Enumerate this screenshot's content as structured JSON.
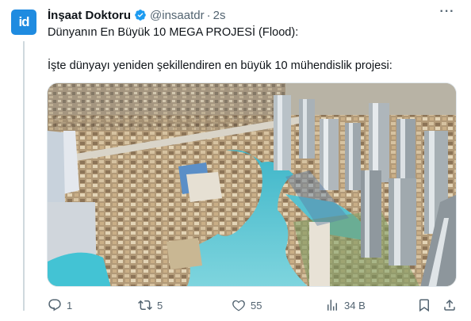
{
  "author": {
    "avatar_text": "id",
    "name": "İnşaat Doktoru",
    "handle": "@insaatdr",
    "separator": "·",
    "time": "2s",
    "avatar_color": "#1f8be0",
    "verified_color": "#1d9bf0"
  },
  "tweet": {
    "line1": "Dünyanın En Büyük 10 MEGA PROJESİ (Flood):",
    "line2": "İşte dünyayı yeniden şekillendiren en büyük 10 mühendislik projesi:"
  },
  "media": {
    "icon": "aerial-city-photo"
  },
  "actions": {
    "reply_count": "1",
    "retweet_count": "5",
    "like_count": "55",
    "views_count": "34 B"
  },
  "icons": {
    "more": "more-icon",
    "reply": "reply-icon",
    "retweet": "retweet-icon",
    "like": "like-icon",
    "views": "views-icon",
    "bookmark": "bookmark-icon",
    "share": "share-icon"
  }
}
